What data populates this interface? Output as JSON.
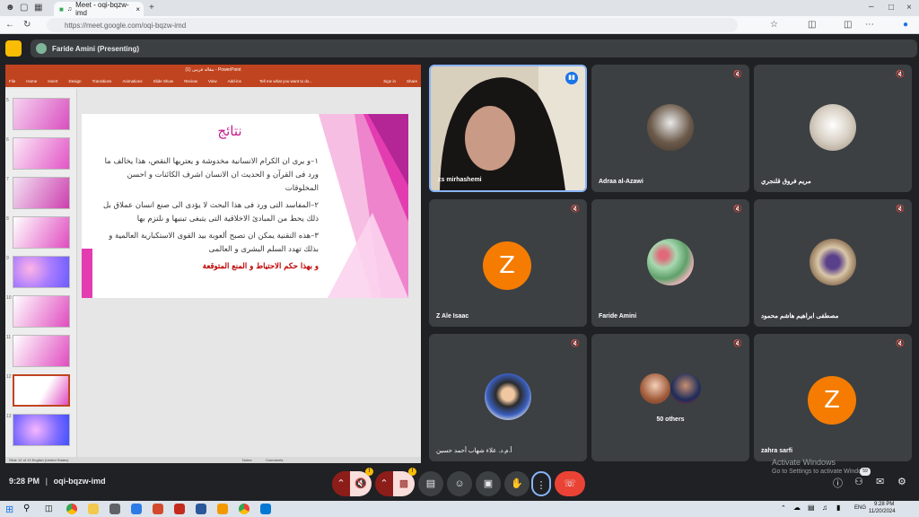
{
  "browser": {
    "tab_title": "Meet - oqi-bqzw-imd",
    "url": "https://meet.google.com/oqi-bqzw-imd"
  },
  "meet": {
    "presenting_label": "Faride Amini (Presenting)",
    "meeting_code": "oqi-bqzw-imd",
    "time": "9:28 PM",
    "activate_windows": "Activate Windows",
    "activate_windows_sub": "Go to Settings to activate Windows.",
    "people_count": "59"
  },
  "ppt": {
    "window_title": "مقاله فریبی (1) - PowerPoint",
    "ribbon": [
      "File",
      "Home",
      "Insert",
      "Design",
      "Transitions",
      "Animations",
      "Slide Show",
      "Review",
      "View",
      "Add-ins"
    ],
    "tell_me": "Tell me what you want to do...",
    "sign_in": "Sign in",
    "share": "Share",
    "status": "Slide 12 of 13   English (United States)",
    "notes": "Notes",
    "comments": "Comments",
    "thumb_numbers": [
      "5",
      "6",
      "7",
      "8",
      "9",
      "10",
      "11",
      "12",
      "13"
    ]
  },
  "slide": {
    "title": "نتائج",
    "lines": [
      "١–و يرى ان الكرام الانسانية مخدوشة و يعتريها النقص، هذا يخالف ما",
      "ورد فى القرآن و الحديث ان الانسان اشرف الكائنات و احسن",
      "المخلوقات",
      "٢–المفاسد التى ورد فى هذا البحث لا يؤدى الى صنع انسان عملاق بل",
      "ذلك يحط من المبادئ الاخلاقية التى يتبغى تبنيها و نلتزم بها",
      "٣–هذه التقنية يمكن ان تصبح ألعوبة بيد القوى الاستكبارية العالمية و",
      "بذلك تهدد السلم البشرى و العالمى"
    ],
    "red_line": "و بهذا حكم الاحتياط و المنع المتوقعة"
  },
  "tiles": [
    {
      "name": "zs mirhashemi"
    },
    {
      "name": "Adraa al-Azawi"
    },
    {
      "name": "مريم فروق قلنجري"
    },
    {
      "name": "Z Ale Isaac",
      "letter": "Z"
    },
    {
      "name": "Faride Amini"
    },
    {
      "name": "مصطفى ابراهيم هاشم محمود"
    },
    {
      "name": "أ.م.د. علاء شهاب أحمد حسين"
    },
    {
      "name": "50 others"
    },
    {
      "name": "zahra sarfi",
      "letter": "Z"
    }
  ],
  "taskbar": {
    "lang": "ENG",
    "time": "9:28 PM",
    "date": "11/20/2024"
  },
  "colors": {
    "meet_bg": "#202124",
    "tile_bg": "#3c4043",
    "avatar_orange": "#f57c00",
    "end_call_red": "#ea4335",
    "ppt_red": "#c0441f",
    "slide_title_pink": "#c51f8c"
  },
  "icons": [
    "mic-off-icon",
    "camera-off-icon",
    "captions-icon",
    "emoji-icon",
    "present-icon",
    "raise-hand-icon",
    "more-options-icon",
    "end-call-icon",
    "info-icon",
    "people-icon",
    "chat-icon",
    "activities-icon"
  ]
}
